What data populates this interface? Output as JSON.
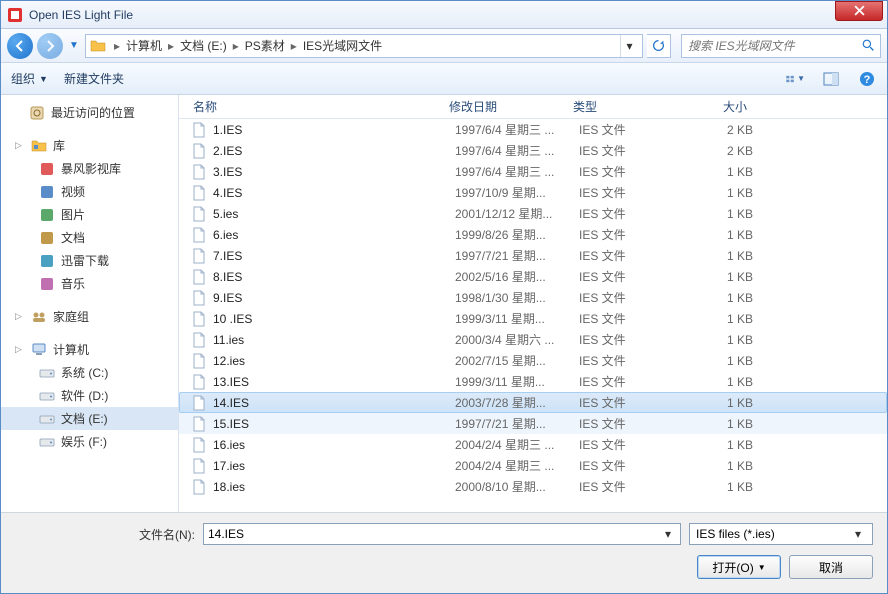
{
  "window": {
    "title": "Open IES Light File"
  },
  "breadcrumb": [
    "计算机",
    "文档 (E:)",
    "PS素材",
    "IES光域网文件"
  ],
  "search": {
    "placeholder": "搜索 IES光域网文件"
  },
  "toolbar": {
    "organize": "组织",
    "newfolder": "新建文件夹"
  },
  "sidebar": {
    "recent": {
      "label": "最近访问的位置"
    },
    "library": {
      "label": "库",
      "items": [
        "暴风影视库",
        "视频",
        "图片",
        "文档",
        "迅雷下载",
        "音乐"
      ]
    },
    "homegroup": {
      "label": "家庭组"
    },
    "computer": {
      "label": "计算机",
      "items": [
        "系统 (C:)",
        "软件 (D:)",
        "文档 (E:)",
        "娱乐 (F:)"
      ],
      "selected_index": 2
    }
  },
  "columns": {
    "name": "名称",
    "date": "修改日期",
    "type": "类型",
    "size": "大小"
  },
  "files": [
    {
      "name": "1.IES",
      "date": "1997/6/4 星期三 ...",
      "type": "IES 文件",
      "size": "2 KB"
    },
    {
      "name": "2.IES",
      "date": "1997/6/4 星期三 ...",
      "type": "IES 文件",
      "size": "2 KB"
    },
    {
      "name": "3.IES",
      "date": "1997/6/4 星期三 ...",
      "type": "IES 文件",
      "size": "1 KB"
    },
    {
      "name": "4.IES",
      "date": "1997/10/9 星期...",
      "type": "IES 文件",
      "size": "1 KB"
    },
    {
      "name": "5.ies",
      "date": "2001/12/12 星期...",
      "type": "IES 文件",
      "size": "1 KB"
    },
    {
      "name": "6.ies",
      "date": "1999/8/26 星期...",
      "type": "IES 文件",
      "size": "1 KB"
    },
    {
      "name": "7.IES",
      "date": "1997/7/21 星期...",
      "type": "IES 文件",
      "size": "1 KB"
    },
    {
      "name": "8.IES",
      "date": "2002/5/16 星期...",
      "type": "IES 文件",
      "size": "1 KB"
    },
    {
      "name": "9.IES",
      "date": "1998/1/30 星期...",
      "type": "IES 文件",
      "size": "1 KB"
    },
    {
      "name": "10 .IES",
      "date": "1999/3/11 星期...",
      "type": "IES 文件",
      "size": "1 KB"
    },
    {
      "name": "11.ies",
      "date": "2000/3/4 星期六 ...",
      "type": "IES 文件",
      "size": "1 KB"
    },
    {
      "name": "12.ies",
      "date": "2002/7/15 星期...",
      "type": "IES 文件",
      "size": "1 KB"
    },
    {
      "name": "13.IES",
      "date": "1999/3/11 星期...",
      "type": "IES 文件",
      "size": "1 KB"
    },
    {
      "name": "14.IES",
      "date": "2003/7/28 星期...",
      "type": "IES 文件",
      "size": "1 KB"
    },
    {
      "name": "15.IES",
      "date": "1997/7/21 星期...",
      "type": "IES 文件",
      "size": "1 KB"
    },
    {
      "name": "16.ies",
      "date": "2004/2/4 星期三 ...",
      "type": "IES 文件",
      "size": "1 KB"
    },
    {
      "name": "17.ies",
      "date": "2004/2/4 星期三 ...",
      "type": "IES 文件",
      "size": "1 KB"
    },
    {
      "name": "18.ies",
      "date": "2000/8/10 星期...",
      "type": "IES 文件",
      "size": "1 KB"
    }
  ],
  "selected_file_index": 13,
  "near_file_index": 14,
  "footer": {
    "filename_label": "文件名(N):",
    "filename_value": "14.IES",
    "filetype": "IES files (*.ies)",
    "open": "打开(O)",
    "cancel": "取消"
  }
}
